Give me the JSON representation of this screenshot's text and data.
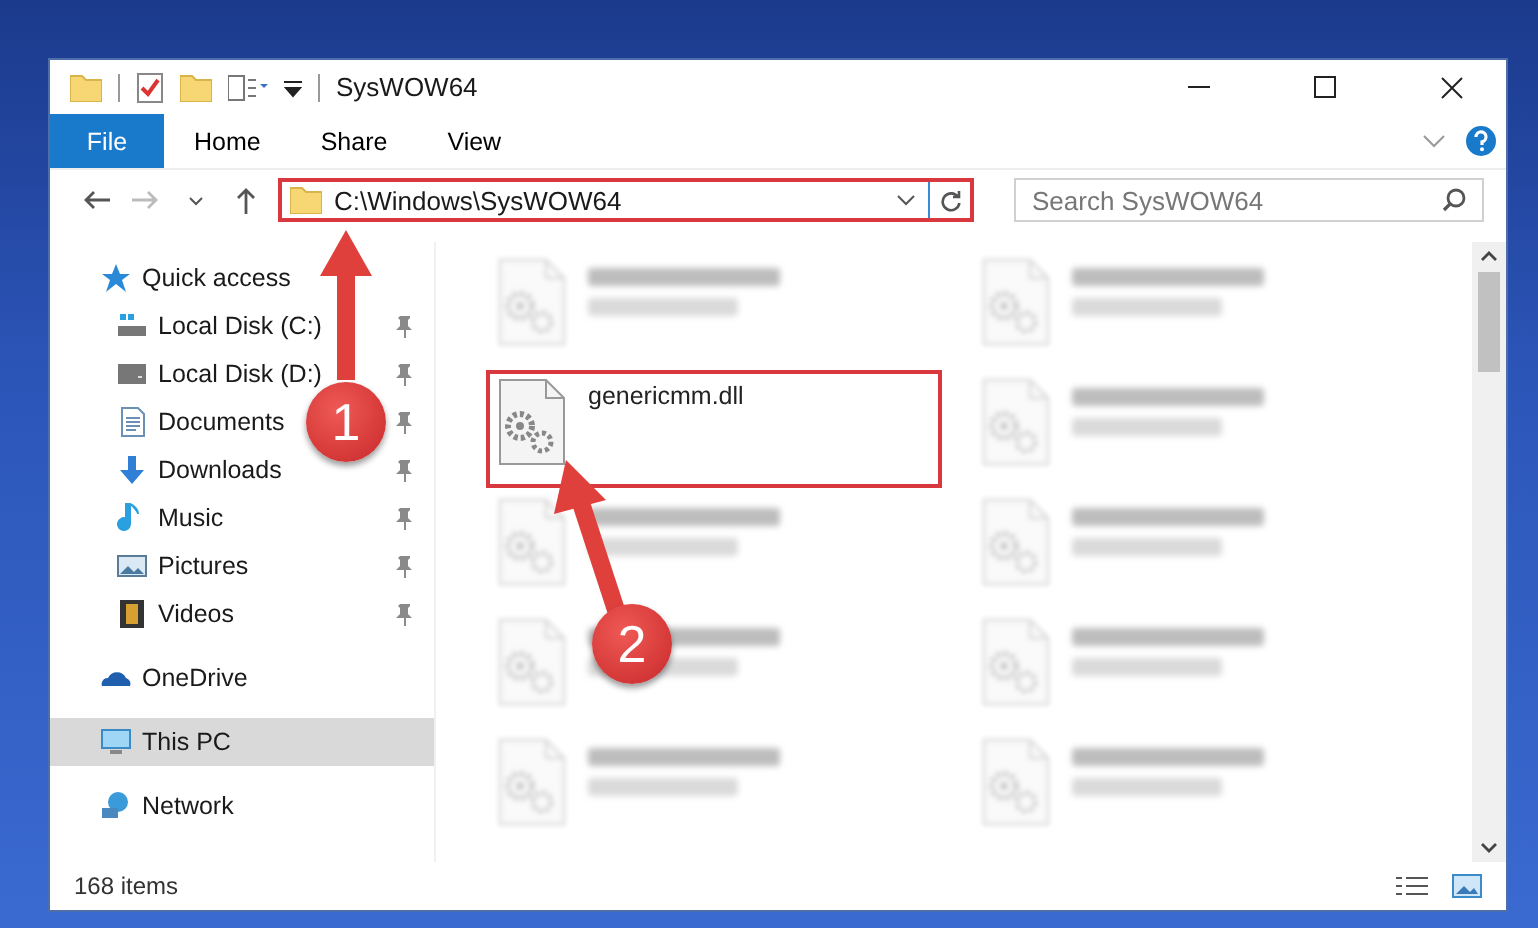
{
  "window": {
    "title": "SysWOW64"
  },
  "ribbon": {
    "file_button": "File",
    "tabs": [
      {
        "label": "Home"
      },
      {
        "label": "Share"
      },
      {
        "label": "View"
      }
    ]
  },
  "address_bar": {
    "path": "C:\\Windows\\SysWOW64"
  },
  "search": {
    "placeholder": "Search SysWOW64"
  },
  "sidebar": {
    "items": [
      {
        "label": "Quick access",
        "kind": "quick",
        "selected": false,
        "children": [
          {
            "label": "Local Disk (C:)",
            "kind": "drive-c",
            "pinned": true,
            "selected": false
          },
          {
            "label": "Local Disk (D:)",
            "kind": "drive",
            "pinned": true,
            "selected": false
          },
          {
            "label": "Documents",
            "kind": "documents",
            "pinned": true,
            "selected": false
          },
          {
            "label": "Downloads",
            "kind": "downloads",
            "pinned": true,
            "selected": false
          },
          {
            "label": "Music",
            "kind": "music",
            "pinned": true,
            "selected": false
          },
          {
            "label": "Pictures",
            "kind": "pictures",
            "pinned": true,
            "selected": false
          },
          {
            "label": "Videos",
            "kind": "videos",
            "pinned": true,
            "selected": false
          }
        ]
      },
      {
        "label": "OneDrive",
        "kind": "onedrive",
        "selected": false
      },
      {
        "label": "This PC",
        "kind": "pc",
        "selected": true
      },
      {
        "label": "Network",
        "kind": "network",
        "selected": false
      }
    ]
  },
  "files": [
    {
      "blurred": true
    },
    {
      "blurred": true
    },
    {
      "name": "genericmm.dll",
      "blurred": false
    },
    {
      "blurred": true
    },
    {
      "blurred": true
    },
    {
      "blurred": true
    },
    {
      "blurred": true
    },
    {
      "blurred": true
    },
    {
      "blurred": true
    },
    {
      "blurred": true
    }
  ],
  "status_bar": {
    "count": "168 items"
  },
  "annotations": [
    {
      "number": "1"
    },
    {
      "number": "2"
    }
  ]
}
